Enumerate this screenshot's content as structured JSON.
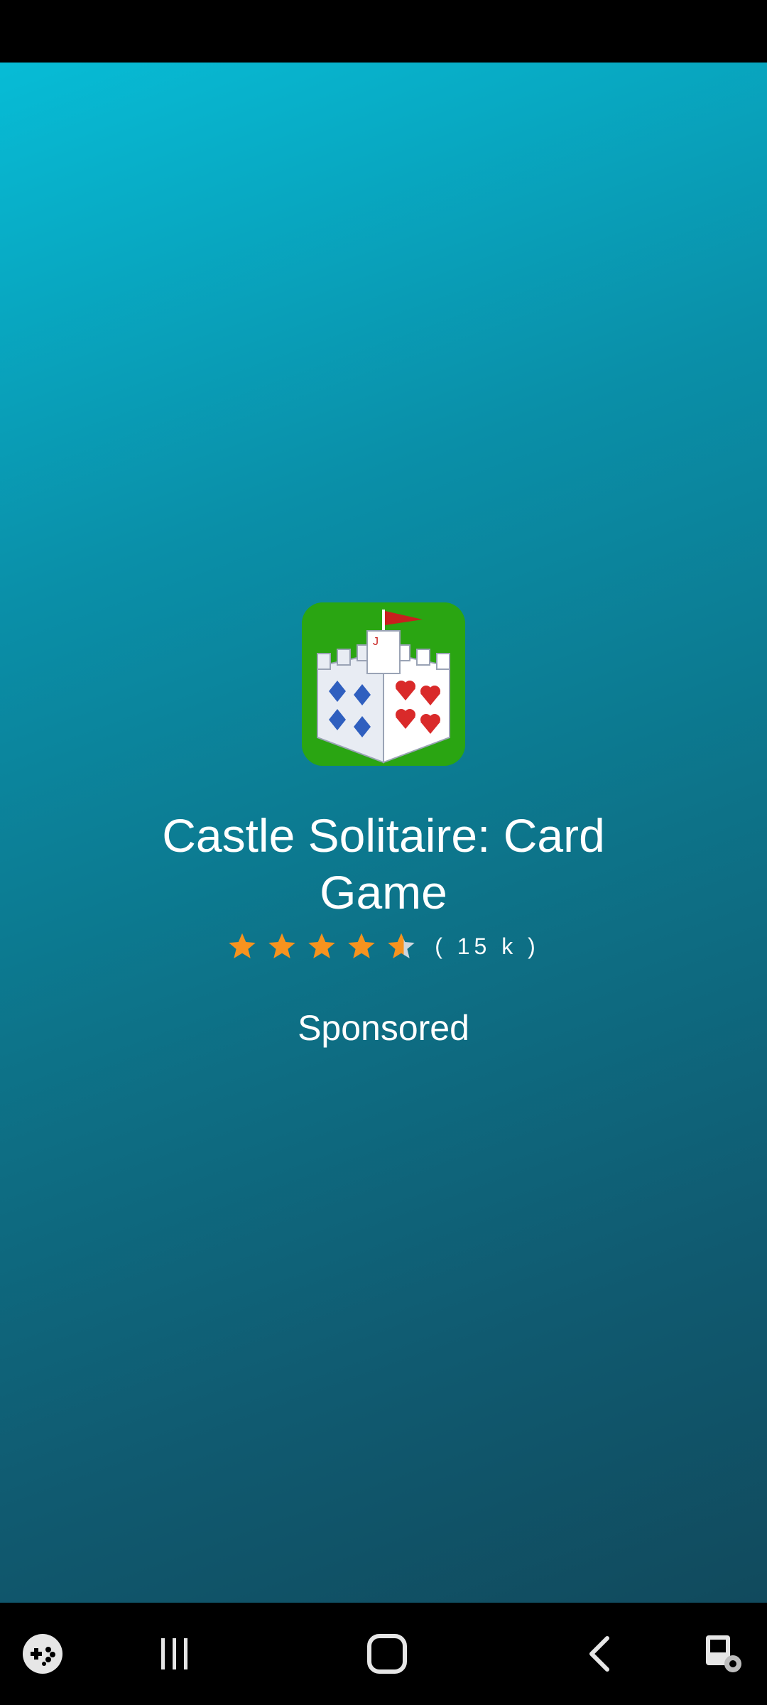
{
  "ad": {
    "app_name": "Castle Solitaire: Card Game",
    "rating": 4.6,
    "rating_max": 5,
    "rating_count": "( 15 k )",
    "sponsored_label": "Sponsored",
    "star_color": "#f7931e",
    "icon_bg_color": "#2aa512"
  },
  "navigation": {
    "buttons": [
      "game-launcher-icon",
      "recent-apps-icon",
      "home-icon",
      "back-icon",
      "screen-capture-icon"
    ]
  }
}
